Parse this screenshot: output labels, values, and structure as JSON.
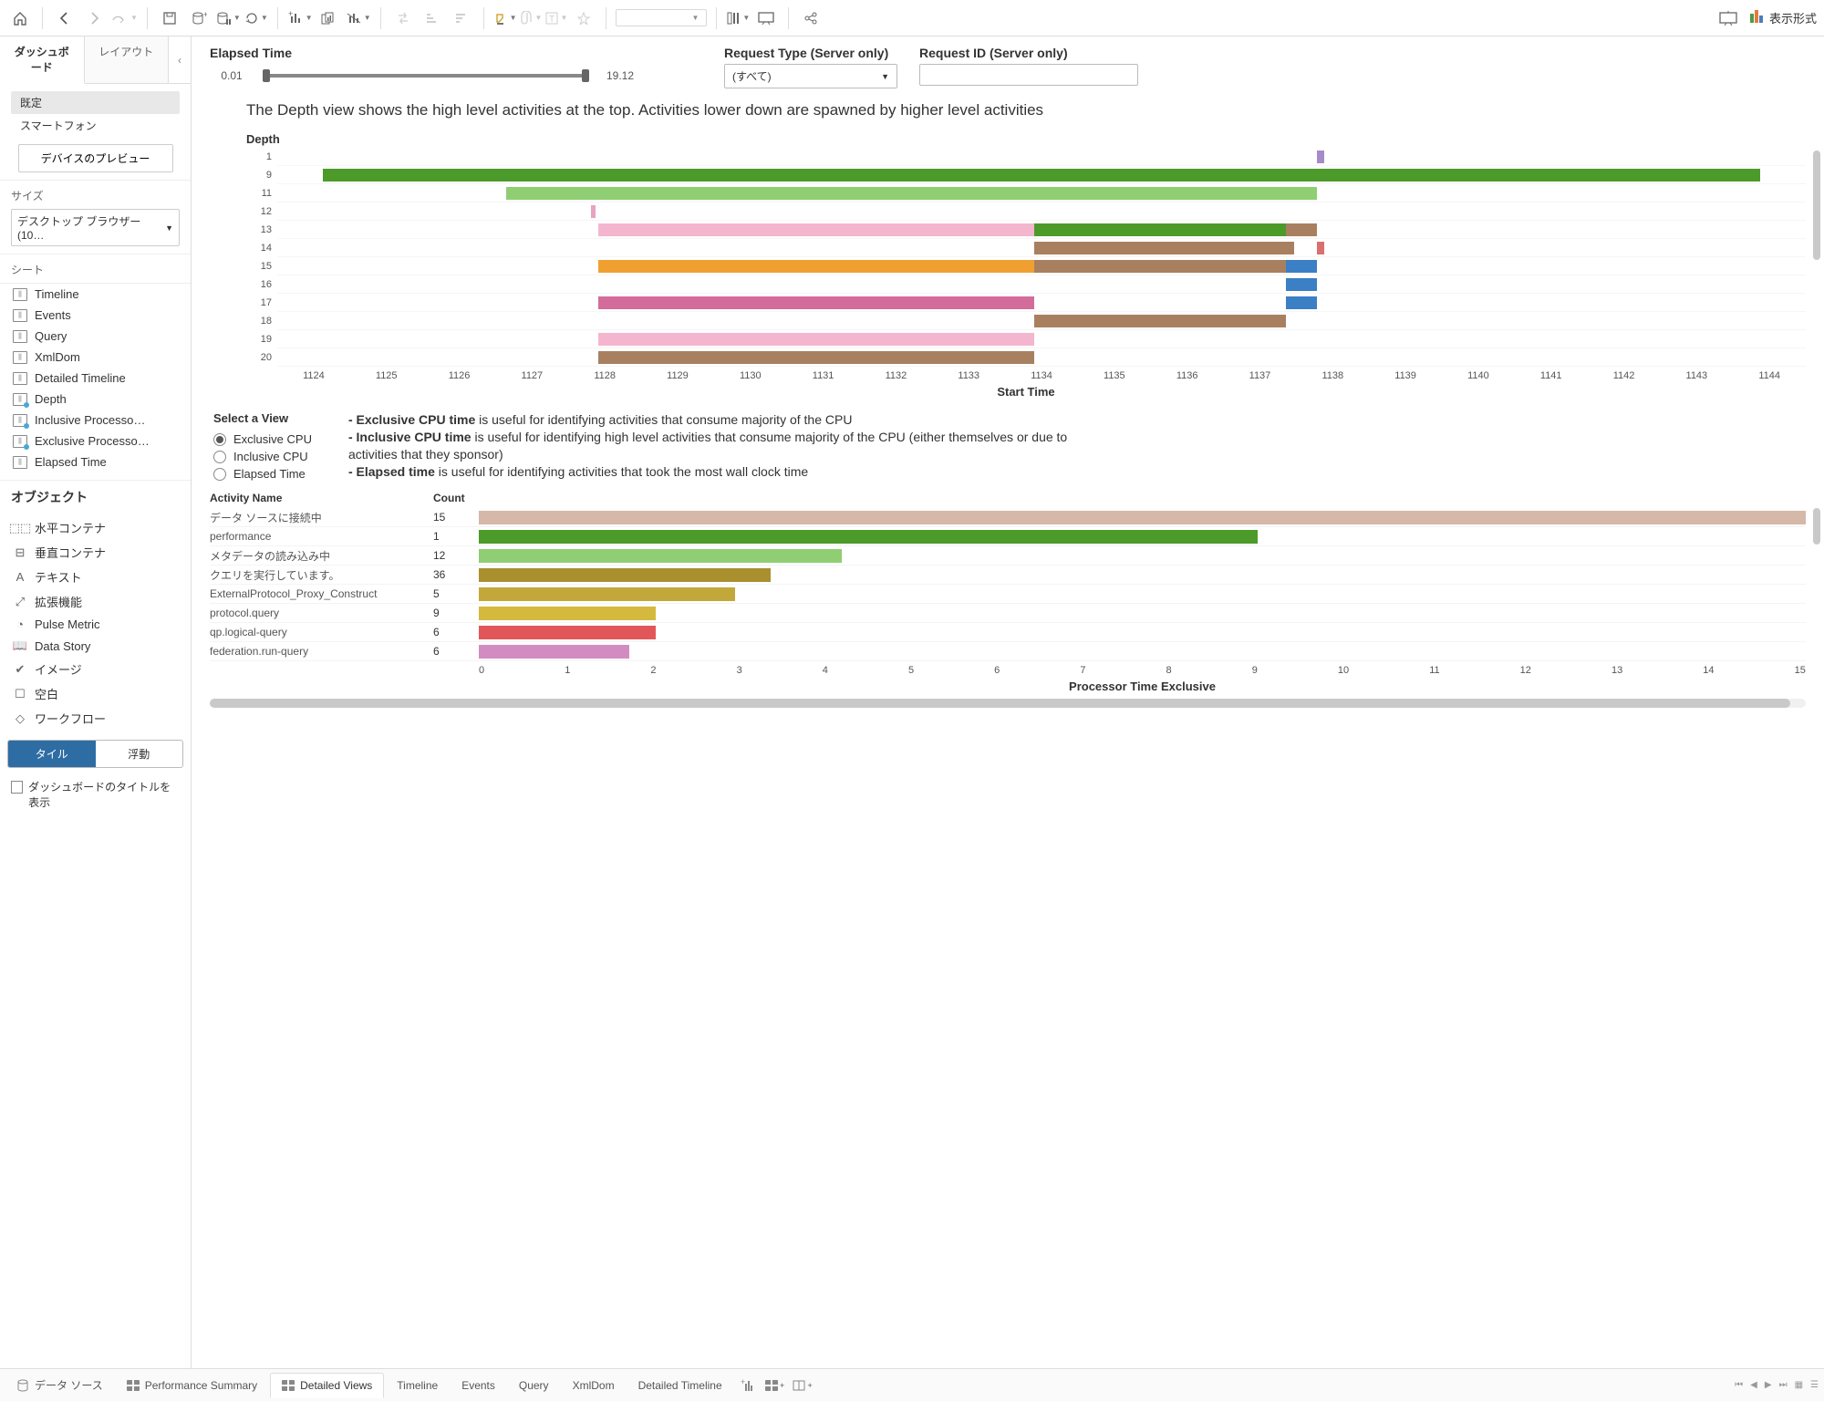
{
  "toolbar": {
    "show_me_label": "表示形式"
  },
  "sidebar": {
    "tabs": {
      "dashboard": "ダッシュボード",
      "layout": "レイアウト"
    },
    "device": {
      "default": "既定",
      "smartphone": "スマートフォン",
      "preview_btn": "デバイスのプレビュー"
    },
    "size": {
      "title": "サイズ",
      "value": "デスクトップ ブラウザー (10…"
    },
    "sheets_title": "シート",
    "sheets": [
      {
        "label": "Timeline"
      },
      {
        "label": "Events"
      },
      {
        "label": "Query"
      },
      {
        "label": "XmlDom"
      },
      {
        "label": "Detailed Timeline"
      },
      {
        "label": "Depth",
        "marked": true
      },
      {
        "label": "Inclusive Processo…",
        "marked": true
      },
      {
        "label": "Exclusive Processo…",
        "marked": true
      },
      {
        "label": "Elapsed Time"
      }
    ],
    "objects_title": "オブジェクト",
    "objects": [
      {
        "icon": "⬚⬚",
        "label": "水平コンテナ"
      },
      {
        "icon": "⊟",
        "label": "垂直コンテナ"
      },
      {
        "icon": "A",
        "label": "テキスト"
      },
      {
        "icon": "⤢",
        "label": "拡張機能"
      },
      {
        "icon": "◔",
        "label": "Pulse Metric"
      },
      {
        "icon": "📖",
        "label": "Data Story"
      },
      {
        "icon": "✔",
        "label": "イメージ"
      },
      {
        "icon": "☐",
        "label": "空白"
      },
      {
        "icon": "◇",
        "label": "ワークフロー"
      }
    ],
    "tile": "タイル",
    "float": "浮動",
    "title_check": "ダッシュボードのタイトルを表示"
  },
  "filters": {
    "elapsed": {
      "label": "Elapsed Time",
      "min": "0.01",
      "max": "19.12"
    },
    "req_type": {
      "label": "Request Type (Server only)",
      "value": "(すべて)"
    },
    "req_id": {
      "label": "Request ID (Server only)"
    }
  },
  "description": "The Depth view shows the high level activities at the top. Activities lower down are spawned by higher level activities",
  "depth": {
    "title": "Depth",
    "y": [
      "1",
      "9",
      "11",
      "12",
      "13",
      "14",
      "15",
      "16",
      "17",
      "18",
      "19",
      "20"
    ],
    "x": [
      "1124",
      "1125",
      "1126",
      "1127",
      "1128",
      "1129",
      "1130",
      "1131",
      "1132",
      "1133",
      "1134",
      "1135",
      "1136",
      "1137",
      "1138",
      "1139",
      "1140",
      "1141",
      "1142",
      "1143",
      "1144"
    ],
    "axis_label": "Start Time"
  },
  "select_view": {
    "title": "Select a View",
    "options": [
      "Exclusive CPU",
      "Inclusive CPU",
      "Elapsed Time"
    ],
    "selected": 0,
    "info_excl_b": "- Exclusive CPU time",
    "info_excl_t": " is useful for identifying activities that consume majority of the CPU",
    "info_incl_b": "- Inclusive CPU time",
    "info_incl_t": " is useful for identifying high level activities that consume majority of the CPU (either themselves or due to activities that they sponsor)",
    "info_elap_b": "- Elapsed time",
    "info_elap_t": " is useful for identifying activities that took the most wall clock time"
  },
  "activity": {
    "col1": "Activity Name",
    "col2": "Count",
    "axis_label": "Processor Time Exclusive",
    "x": [
      "0",
      "1",
      "2",
      "3",
      "4",
      "5",
      "6",
      "7",
      "8",
      "9",
      "10",
      "11",
      "12",
      "13",
      "14",
      "15"
    ]
  },
  "chart_data": [
    {
      "type": "bar",
      "orientation": "horizontal-gantt",
      "title": "Depth",
      "xlabel": "Start Time",
      "ylabel": "Depth",
      "xlim": [
        1124,
        1144
      ],
      "y_categories": [
        "1",
        "9",
        "11",
        "12",
        "13",
        "14",
        "15",
        "16",
        "17",
        "18",
        "19",
        "20"
      ],
      "bars": [
        {
          "depth": "1",
          "start": 1137.6,
          "end": 1137.7,
          "color": "#a78bc9"
        },
        {
          "depth": "9",
          "start": 1124.6,
          "end": 1143.4,
          "color": "#4c9a2a"
        },
        {
          "depth": "11",
          "start": 1127.0,
          "end": 1137.6,
          "color": "#8fce72"
        },
        {
          "depth": "12",
          "start": 1128.1,
          "end": 1128.15,
          "color": "#e7a3c0"
        },
        {
          "depth": "13",
          "start": 1128.2,
          "end": 1133.9,
          "color": "#f4b6cf"
        },
        {
          "depth": "13",
          "start": 1133.9,
          "end": 1137.2,
          "color": "#4c9a2a"
        },
        {
          "depth": "13",
          "start": 1137.2,
          "end": 1137.6,
          "color": "#a88060"
        },
        {
          "depth": "14",
          "start": 1133.9,
          "end": 1137.3,
          "color": "#a88060"
        },
        {
          "depth": "14",
          "start": 1137.6,
          "end": 1137.7,
          "color": "#d97070"
        },
        {
          "depth": "15",
          "start": 1128.2,
          "end": 1133.9,
          "color": "#f0a030"
        },
        {
          "depth": "15",
          "start": 1133.9,
          "end": 1137.2,
          "color": "#a88060"
        },
        {
          "depth": "15",
          "start": 1137.2,
          "end": 1137.6,
          "color": "#3b7fc4"
        },
        {
          "depth": "16",
          "start": 1137.2,
          "end": 1137.6,
          "color": "#3b7fc4"
        },
        {
          "depth": "17",
          "start": 1128.2,
          "end": 1133.9,
          "color": "#d36c9a"
        },
        {
          "depth": "17",
          "start": 1137.2,
          "end": 1137.6,
          "color": "#3b7fc4"
        },
        {
          "depth": "18",
          "start": 1133.9,
          "end": 1137.2,
          "color": "#a88060"
        },
        {
          "depth": "19",
          "start": 1128.2,
          "end": 1133.9,
          "color": "#f4b6cf"
        },
        {
          "depth": "20",
          "start": 1128.2,
          "end": 1133.9,
          "color": "#a88060"
        }
      ]
    },
    {
      "type": "bar",
      "orientation": "horizontal",
      "xlabel": "Processor Time Exclusive",
      "xlim": [
        0,
        15
      ],
      "rows": [
        {
          "name": "データ ソースに接続中",
          "count": 15,
          "value": 15.0,
          "color": "#d5b8a8"
        },
        {
          "name": "performance",
          "count": 1,
          "value": 8.8,
          "color": "#4c9a2a"
        },
        {
          "name": "メタデータの読み込み中",
          "count": 12,
          "value": 4.1,
          "color": "#8fce72"
        },
        {
          "name": "クエリを実行しています。",
          "count": 36,
          "value": 3.3,
          "color": "#aa8f2f"
        },
        {
          "name": "ExternalProtocol_Proxy_Construct",
          "count": 5,
          "value": 2.9,
          "color": "#c2a83a"
        },
        {
          "name": "protocol.query",
          "count": 9,
          "value": 2.0,
          "color": "#d4b93e"
        },
        {
          "name": "qp.logical-query",
          "count": 6,
          "value": 2.0,
          "color": "#e15759"
        },
        {
          "name": "federation.run-query",
          "count": 6,
          "value": 1.7,
          "color": "#d38cc2"
        }
      ]
    }
  ],
  "bottom_tabs": {
    "datasource": "データ ソース",
    "tabs": [
      "Performance Summary",
      "Detailed Views",
      "Timeline",
      "Events",
      "Query",
      "XmlDom",
      "Detailed Timeline"
    ],
    "active": 1
  }
}
